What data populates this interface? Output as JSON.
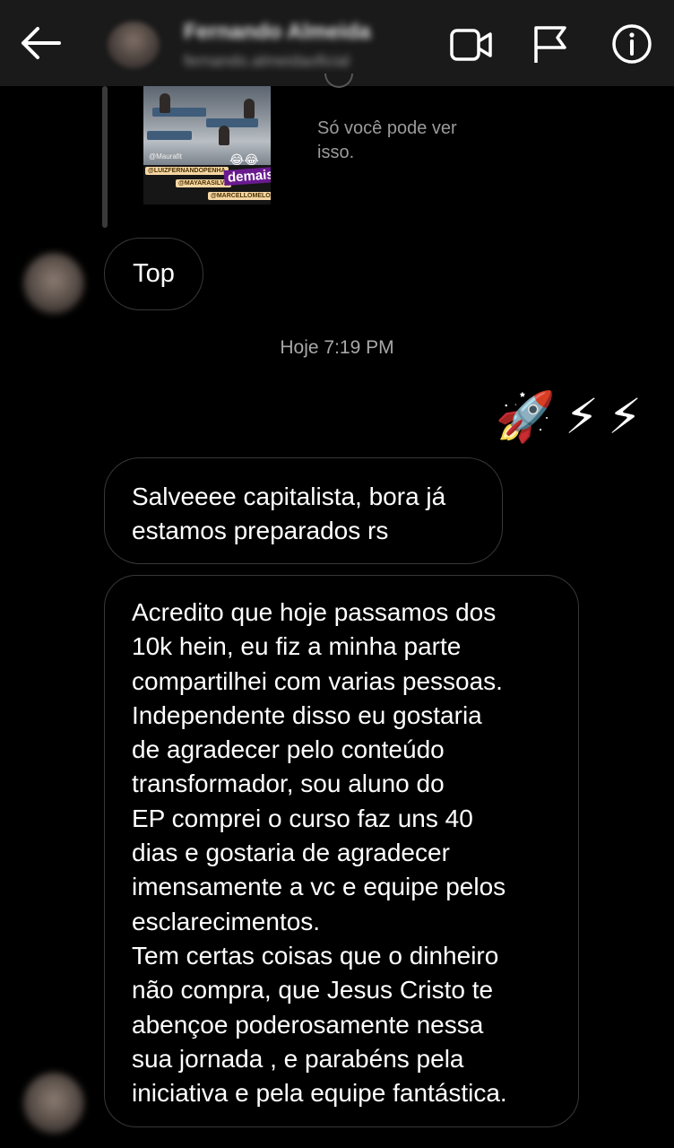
{
  "header": {
    "contact_name": "Fernando Almeida",
    "contact_handle": "fernando.almeidaoficial",
    "back_icon": "arrow-left-icon",
    "video_icon": "video-call-icon",
    "flag_icon": "flag-icon",
    "info_icon": "info-icon"
  },
  "shared_story": {
    "credit": "@Maurafit",
    "emoji": "😂😂",
    "tags": [
      "@LUIZFERNANDOPENHA",
      "@MAYARASILVA",
      "@MARCELLOMELO"
    ],
    "sticker": "demais",
    "private_note": "Só você pode ver isso."
  },
  "messages": {
    "top": "Top",
    "timestamp": "Hoje 7:19 PM",
    "reactions": "🚀⚡⚡",
    "salve_lines": [
      "Salveeee capitalista, bora já",
      "estamos preparados rs"
    ],
    "long_lines": [
      "Acredito que hoje passamos dos",
      "10k hein, eu fiz a minha parte",
      "compartilhei com varias pessoas.",
      "Independente disso eu gostaria",
      "de agradecer pelo conteúdo",
      "transformador, sou aluno do",
      "EP comprei o curso faz uns 40",
      "dias e gostaria de agradecer",
      "imensamente a vc e equipe pelos",
      "esclarecimentos.",
      "Tem certas coisas que o dinheiro",
      "não compra, que Jesus Cristo te",
      "abençoe poderosamente nessa",
      "sua jornada , e parabéns pela",
      "iniciativa e pela equipe fantástica."
    ]
  },
  "colors": {
    "background": "#000000",
    "header": "#1a1a1a",
    "bubble_border": "#383838",
    "muted_text": "#a8a8a8"
  }
}
